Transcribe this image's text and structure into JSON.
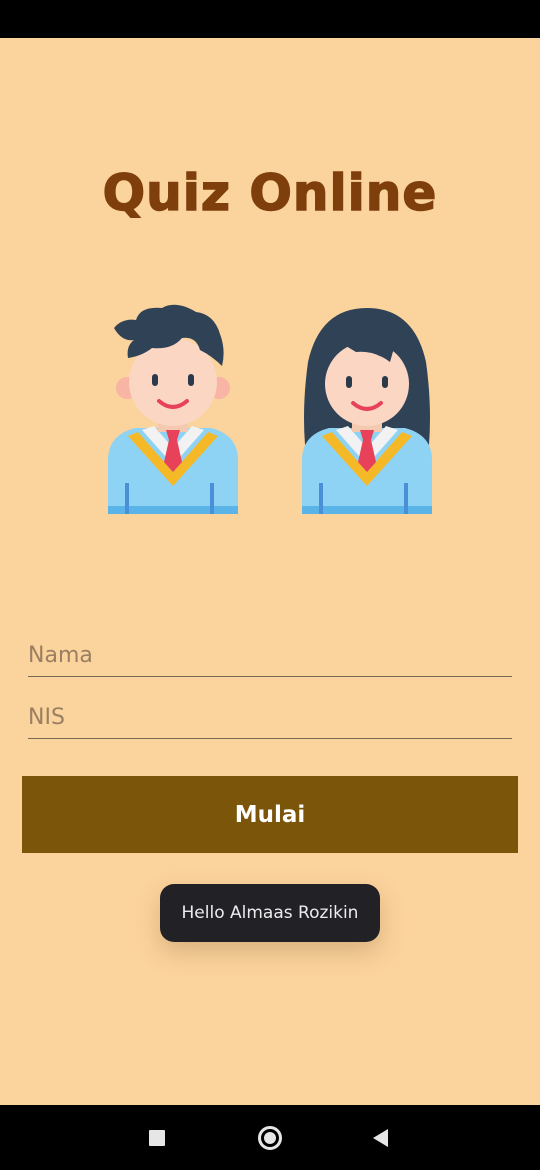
{
  "app": {
    "title": "Quiz Online"
  },
  "form": {
    "name_placeholder": "Nama",
    "nis_placeholder": "NIS",
    "name_value": "",
    "nis_value": ""
  },
  "actions": {
    "start_label": "Mulai"
  },
  "toast": {
    "message": "Hello Almaas Rozikin"
  },
  "icons": {
    "boy": "student-boy-icon",
    "girl": "student-girl-icon",
    "recent": "recent-apps-icon",
    "home": "home-icon",
    "back": "back-icon"
  },
  "colors": {
    "background": "#fbd39c",
    "title": "#7f3f0c",
    "button": "#7a550a",
    "toast": "#222226"
  }
}
